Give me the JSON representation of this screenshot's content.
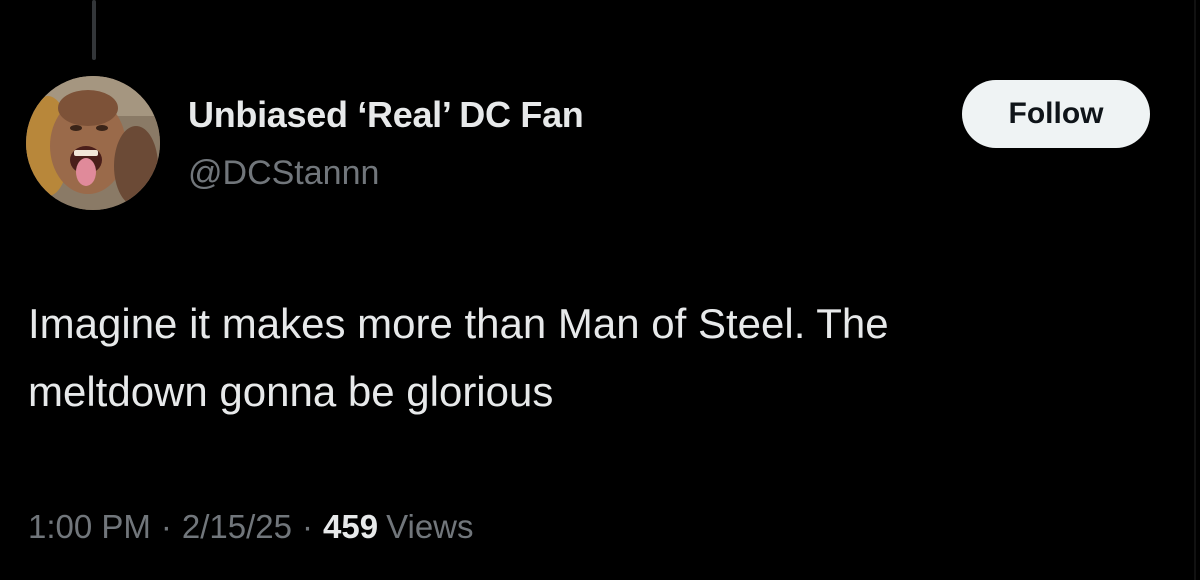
{
  "tweet": {
    "author": {
      "display_name": "Unbiased ‘Real’ DC Fan",
      "handle": "@DCStannn",
      "avatar_icon": "profile-photo"
    },
    "follow_label": "Follow",
    "text_line1": "Imagine it makes more than Man of Steel. The",
    "text_line2": "meltdown gonna be glorious",
    "time": "1:00 PM",
    "date": "2/15/25",
    "separator": "·",
    "views_count": "459",
    "views_label": "Views"
  },
  "colors": {
    "background": "#000000",
    "primary_text": "#e7e9ea",
    "secondary_text": "#71767b",
    "follow_button_bg": "#eff3f4",
    "follow_button_text": "#0f1419"
  }
}
